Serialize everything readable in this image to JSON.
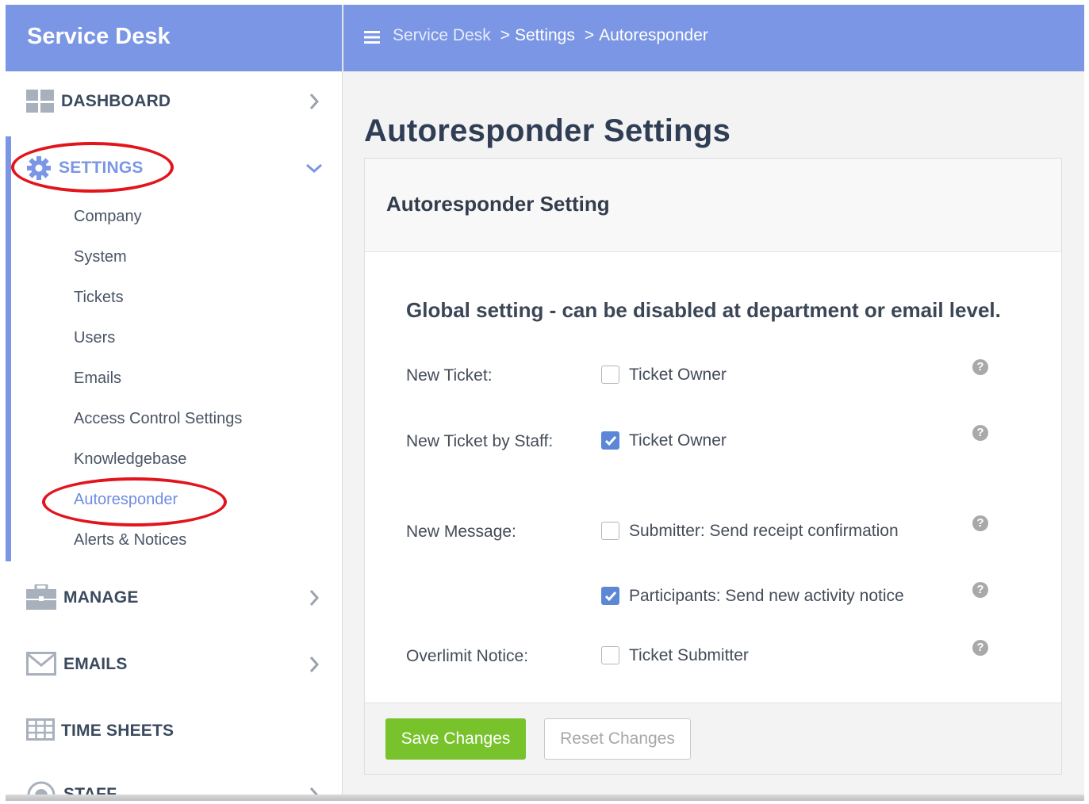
{
  "brand": "Service Desk",
  "breadcrumb": {
    "items": [
      "Service Desk",
      "Settings",
      "Autoresponder"
    ],
    "separator": ">"
  },
  "sidebar": {
    "dashboard": "DASHBOARD",
    "settings": "SETTINGS",
    "settings_items": [
      "Company",
      "System",
      "Tickets",
      "Users",
      "Emails",
      "Access Control Settings",
      "Knowledgebase",
      "Autoresponder",
      "Alerts & Notices"
    ],
    "manage": "MANAGE",
    "emails": "EMAILS",
    "time_sheets": "TIME SHEETS",
    "staff": "STAFF"
  },
  "page": {
    "title": "Autoresponder Settings",
    "card_title": "Autoresponder Setting",
    "global_note": "Global setting - can be disabled at department or email level.",
    "rows": [
      {
        "label": "New Ticket:",
        "option": "Ticket Owner",
        "checked": false
      },
      {
        "label": "New Ticket by Staff:",
        "option": "Ticket Owner",
        "checked": true
      },
      {
        "label": "New Message:",
        "option": "Submitter: Send receipt confirmation",
        "checked": false
      },
      {
        "label": "",
        "option": "Participants: Send new activity notice",
        "checked": true
      },
      {
        "label": "Overlimit Notice:",
        "option": "Ticket Submitter",
        "checked": false
      }
    ],
    "help_glyph": "?"
  },
  "buttons": {
    "save": "Save Changes",
    "reset": "Reset Changes"
  },
  "colors": {
    "header": "#7b96e4",
    "active_link": "#6f8de0",
    "save": "#78c32c",
    "checkbox": "#5b87d6",
    "annotation": "#e2141c"
  },
  "icons": [
    "dashboard-icon",
    "gear-icon",
    "briefcase-icon",
    "envelope-icon",
    "grid-icon",
    "staff-icon",
    "chevron-right-icon",
    "chevron-down-icon",
    "menu-icon",
    "help-icon",
    "checkmark-icon"
  ]
}
